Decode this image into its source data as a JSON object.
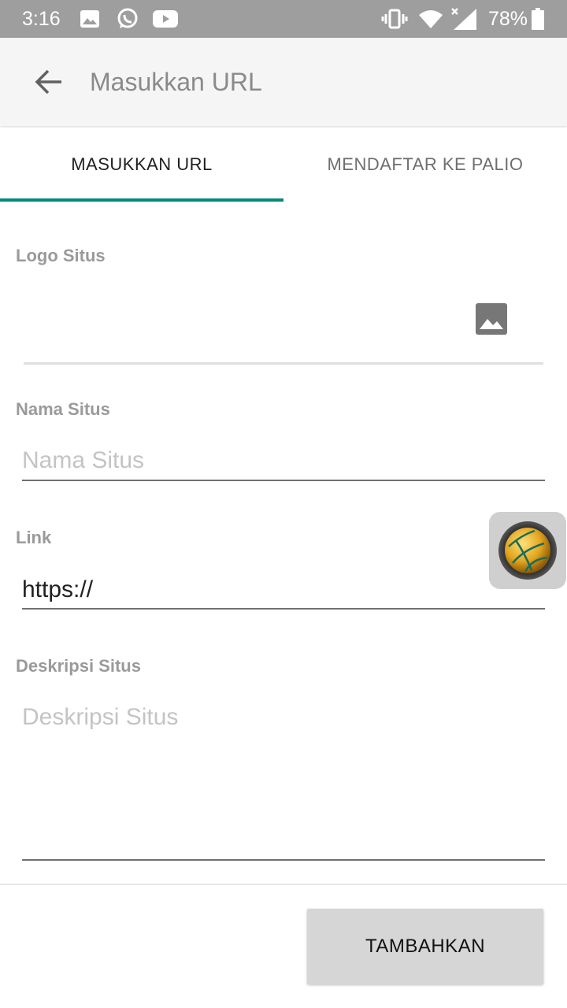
{
  "status_bar": {
    "time": "3:16",
    "battery": "78%",
    "icons": [
      "image-icon",
      "whatsapp-icon",
      "youtube-icon",
      "vibrate-icon",
      "wifi-icon",
      "signal-icon",
      "battery-icon"
    ]
  },
  "app_bar": {
    "title": "Masukkan URL",
    "back_icon": "arrow-back-icon"
  },
  "tabs": [
    {
      "label": "MASUKKAN URL",
      "selected": true
    },
    {
      "label": "MENDAFTAR KE PALIO",
      "selected": false
    }
  ],
  "form": {
    "logo_label": "Logo Situs",
    "name_label": "Nama Situs",
    "name_placeholder": "Nama Situs",
    "link_label": "Link",
    "link_value": "https://",
    "desc_label": "Deskripsi Situs",
    "desc_placeholder": "Deskripsi Situs"
  },
  "submit_button": "TAMBAHKAN",
  "colors": {
    "accent": "#00897b",
    "status_bar": "#9e9e9e",
    "app_bar": "#f5f5f5"
  }
}
